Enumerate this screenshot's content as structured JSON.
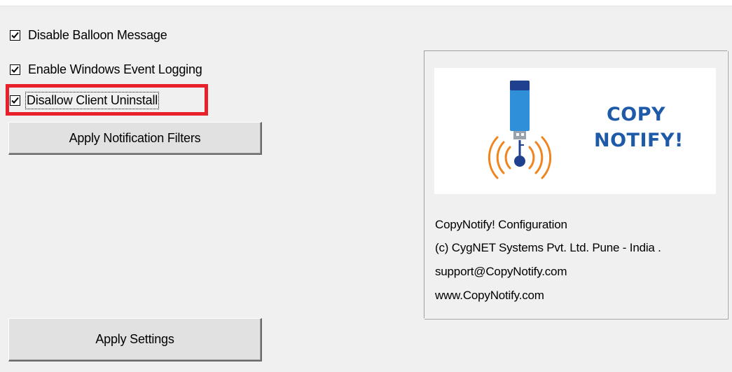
{
  "options": [
    {
      "label": "Disable Balloon Message",
      "checked": true
    },
    {
      "label": "Enable Windows Event Logging",
      "checked": true
    },
    {
      "label": "Disallow Client Uninstall",
      "checked": true
    }
  ],
  "buttons": {
    "apply_filters": "Apply Notification Filters",
    "apply_settings": "Apply Settings"
  },
  "logo": {
    "line1": "COPY",
    "line2": "NOTIFY!",
    "text_color": "#1e5aa8",
    "waves_color": "#f0841e",
    "usb_color": "#2f8fd8"
  },
  "info": {
    "product": "CopyNotify! Configuration",
    "copyright": "(c) CygNET Systems Pvt. Ltd. Pune - India .",
    "email": "support@CopyNotify.com",
    "website": "www.CopyNotify.com"
  },
  "highlight_color": "#e8202a"
}
